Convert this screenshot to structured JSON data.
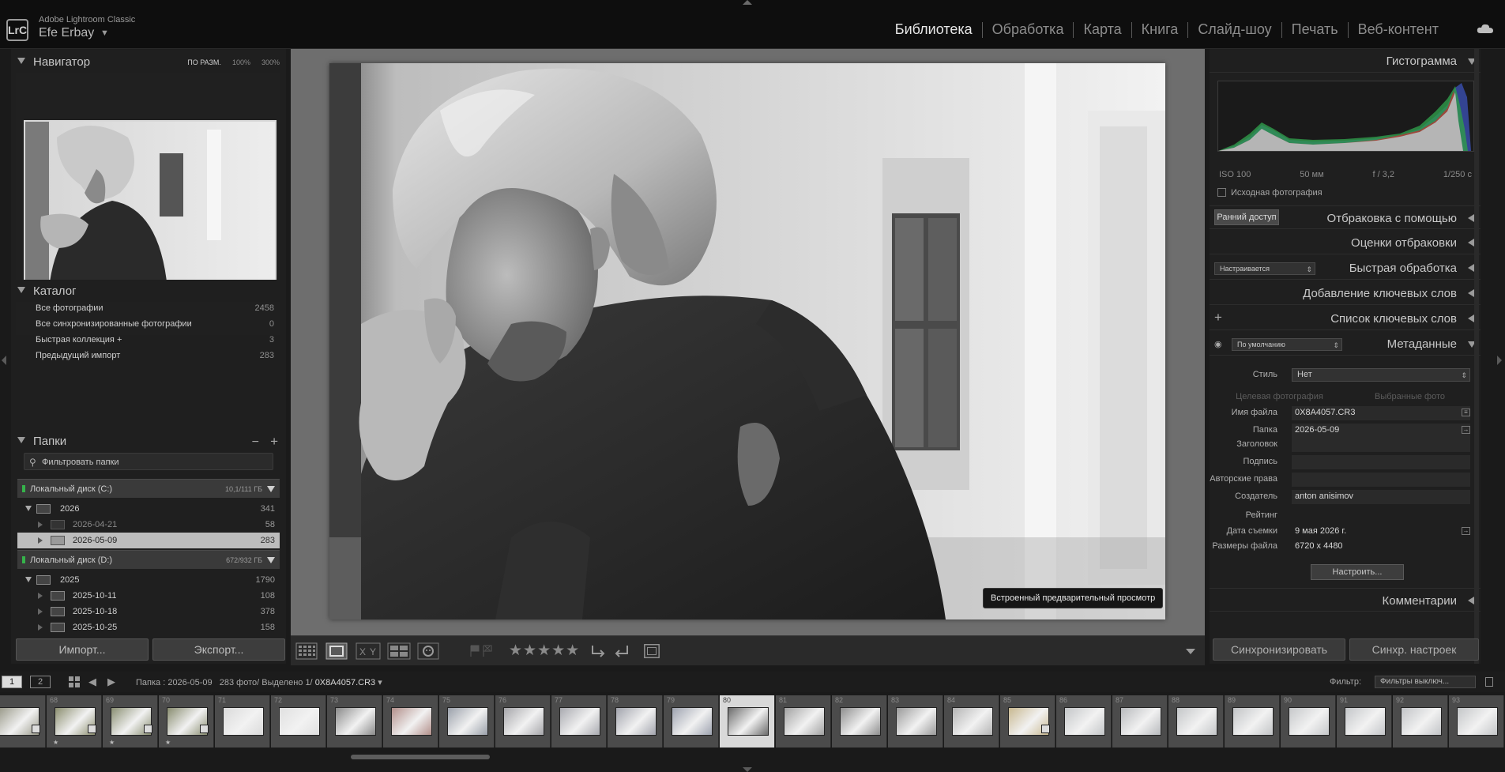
{
  "app": {
    "name": "Adobe Lightroom Classic",
    "logo": "LrC",
    "user": "Efe Erbay"
  },
  "modules": [
    "Библиотека",
    "Обработка",
    "Карта",
    "Книга",
    "Слайд-шоу",
    "Печать",
    "Веб-контент"
  ],
  "active_module": "Библиотека",
  "navigator": {
    "title": "Навигатор",
    "zoom_fit": "ПО РАЗМ.",
    "zoom_100": "100%",
    "zoom_300": "300%"
  },
  "catalog": {
    "title": "Каталог",
    "items": [
      {
        "label": "Все фотографии",
        "count": "2458"
      },
      {
        "label": "Все синхронизированные фотографии",
        "count": "0"
      },
      {
        "label": "Быстрая коллекция +",
        "count": "3"
      },
      {
        "label": "Предыдущий импорт",
        "count": "283"
      }
    ]
  },
  "folders": {
    "title": "Папки",
    "filter_placeholder": "Фильтровать папки",
    "volume_c": {
      "label": "Локальный диск (C:)",
      "size": "10,1/111 ГБ"
    },
    "year_2026": {
      "label": "2026",
      "count": "341"
    },
    "f_2026_04_21": {
      "label": "2026-04-21",
      "count": "58"
    },
    "f_2026_05_09": {
      "label": "2026-05-09",
      "count": "283"
    },
    "volume_d": {
      "label": "Локальный диск (D:)",
      "size": "672/932 ГБ"
    },
    "year_2025": {
      "label": "2025",
      "count": "1790"
    },
    "f_2025_10_11": {
      "label": "2025-10-11",
      "count": "108"
    },
    "f_2025_10_18": {
      "label": "2025-10-18",
      "count": "378"
    },
    "f_2025_10_25": {
      "label": "2025-10-25",
      "count": "158"
    }
  },
  "buttons": {
    "import": "Импорт...",
    "export": "Экспорт...",
    "sync": "Синхронизировать",
    "sync_settings": "Синхр. настроек",
    "customize": "Настроить..."
  },
  "loupe": {
    "overlay": "Встроенный предварительный просмотр",
    "rating_stars": "★★★★★"
  },
  "right": {
    "histogram": "Гистограмма",
    "iso": "ISO 100",
    "focal": "50 мм",
    "aperture": "f / 3,2",
    "shutter": "1/250 с",
    "original_photo": "Исходная фотография",
    "early_access": "Ранний доступ",
    "culling": "Отбраковка с помощью",
    "culling_scores": "Оценки отбраковки",
    "quick_develop": "Быстрая обработка",
    "quick_preset": "Настраивается",
    "keywording": "Добавление ключевых слов",
    "keyword_list": "Список ключевых слов",
    "metadata": "Метаданные",
    "metadata_preset": "По умолчанию",
    "comments": "Комментарии",
    "tab_target": "Целевая фотография",
    "tab_selected": "Выбранные фото"
  },
  "metadata": {
    "style": {
      "label": "Стиль",
      "value": "Нет"
    },
    "filename": {
      "label": "Имя файла",
      "value": "0X8A4057.CR3"
    },
    "folder": {
      "label": "Папка",
      "value": "2026-05-09"
    },
    "headline": {
      "label": "Заголовок",
      "value": ""
    },
    "caption": {
      "label": "Подпись",
      "value": ""
    },
    "copyright": {
      "label": "Авторские права",
      "value": ""
    },
    "creator": {
      "label": "Создатель",
      "value": "anton anisimov"
    },
    "rating": {
      "label": "Рейтинг",
      "value": ""
    },
    "capture_date": {
      "label": "Дата съемки",
      "value": "9 мая 2026 г."
    },
    "dimensions": {
      "label": "Размеры файла",
      "value": "6720 x 4480"
    }
  },
  "filmstrip": {
    "page1": "1",
    "page2": "2",
    "path_prefix": "Папка : 2026-05-09",
    "count_text": "283 фото/ Выделено 1/",
    "current_file": "0X8A4057.CR3",
    "filter_label": "Фильтр:",
    "filter_value": "Фильтры выключ...",
    "cells": [
      {
        "num": "",
        "tone": "#9a9a8a",
        "star": false,
        "badge": true
      },
      {
        "num": "68",
        "tone": "#8b8e6f",
        "star": true,
        "badge": true
      },
      {
        "num": "69",
        "tone": "#8a8f72",
        "star": true,
        "badge": true
      },
      {
        "num": "70",
        "tone": "#888c6f",
        "star": true,
        "badge": true
      },
      {
        "num": "71",
        "tone": "#dadada",
        "star": false,
        "badge": false
      },
      {
        "num": "72",
        "tone": "#e0e0e0",
        "star": false,
        "badge": false
      },
      {
        "num": "73",
        "tone": "#8a8a8a",
        "star": false,
        "badge": false
      },
      {
        "num": "74",
        "tone": "#b28f8a",
        "star": false,
        "badge": false
      },
      {
        "num": "75",
        "tone": "#9aa0aa",
        "star": false,
        "badge": false
      },
      {
        "num": "76",
        "tone": "#a6a6aa",
        "star": false,
        "badge": false
      },
      {
        "num": "77",
        "tone": "#a9aab0",
        "star": false,
        "badge": false
      },
      {
        "num": "78",
        "tone": "#a2a4ad",
        "star": false,
        "badge": false
      },
      {
        "num": "79",
        "tone": "#9ea3b0",
        "star": false,
        "badge": false
      },
      {
        "num": "80",
        "tone": "#6c6c6c",
        "star": false,
        "badge": false
      },
      {
        "num": "81",
        "tone": "#a2a2a2",
        "star": false,
        "badge": false
      },
      {
        "num": "82",
        "tone": "#8e8e8e",
        "star": false,
        "badge": false
      },
      {
        "num": "83",
        "tone": "#9a9a9a",
        "star": false,
        "badge": false
      },
      {
        "num": "84",
        "tone": "#b4b4b4",
        "star": false,
        "badge": false
      },
      {
        "num": "85",
        "tone": "#c8b890",
        "star": false,
        "badge": true
      },
      {
        "num": "86",
        "tone": "#c4c6c8",
        "star": false,
        "badge": false
      },
      {
        "num": "87",
        "tone": "#b8babd",
        "star": false,
        "badge": false
      },
      {
        "num": "88",
        "tone": "#c4c6c8",
        "star": false,
        "badge": false
      },
      {
        "num": "89",
        "tone": "#c2c4c6",
        "star": false,
        "badge": false
      },
      {
        "num": "90",
        "tone": "#c6c8ca",
        "star": false,
        "badge": false
      },
      {
        "num": "91",
        "tone": "#c4c6c9",
        "star": false,
        "badge": false
      },
      {
        "num": "92",
        "tone": "#c2c4c7",
        "star": false,
        "badge": false
      },
      {
        "num": "93",
        "tone": "#c4c6c8",
        "star": false,
        "badge": false
      }
    ]
  },
  "colors": {
    "accent_led": "#35b34a",
    "selected_cell": "#d9d9d9"
  }
}
